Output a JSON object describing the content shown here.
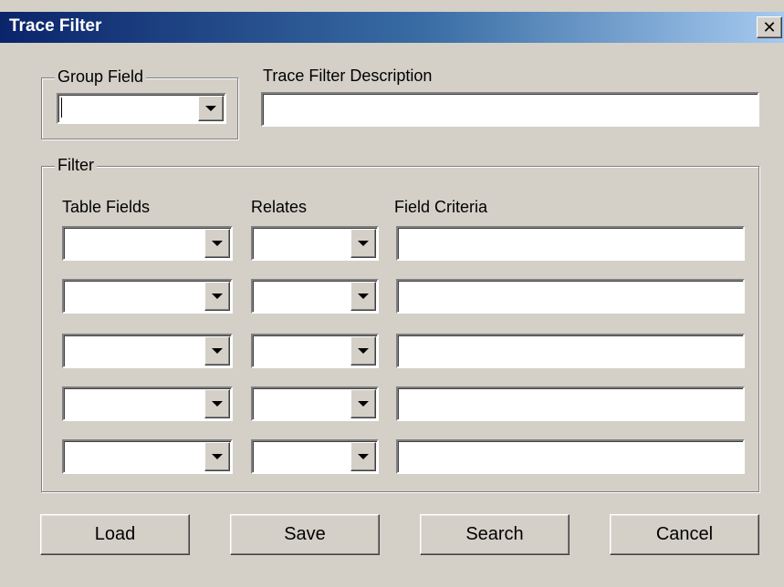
{
  "window": {
    "title": "Trace Filter",
    "close_glyph": "✕"
  },
  "group_field": {
    "legend": "Group Field",
    "value": ""
  },
  "description": {
    "label": "Trace Filter Description",
    "value": ""
  },
  "filter": {
    "legend": "Filter",
    "headers": {
      "table_fields": "Table Fields",
      "relates": "Relates",
      "field_criteria": "Field Criteria"
    },
    "rows": [
      {
        "table_field": "",
        "relate": "",
        "criteria": ""
      },
      {
        "table_field": "",
        "relate": "",
        "criteria": ""
      },
      {
        "table_field": "",
        "relate": "",
        "criteria": ""
      },
      {
        "table_field": "",
        "relate": "",
        "criteria": ""
      },
      {
        "table_field": "",
        "relate": "",
        "criteria": ""
      }
    ]
  },
  "buttons": {
    "load": "Load",
    "save": "Save",
    "search": "Search",
    "cancel": "Cancel"
  }
}
